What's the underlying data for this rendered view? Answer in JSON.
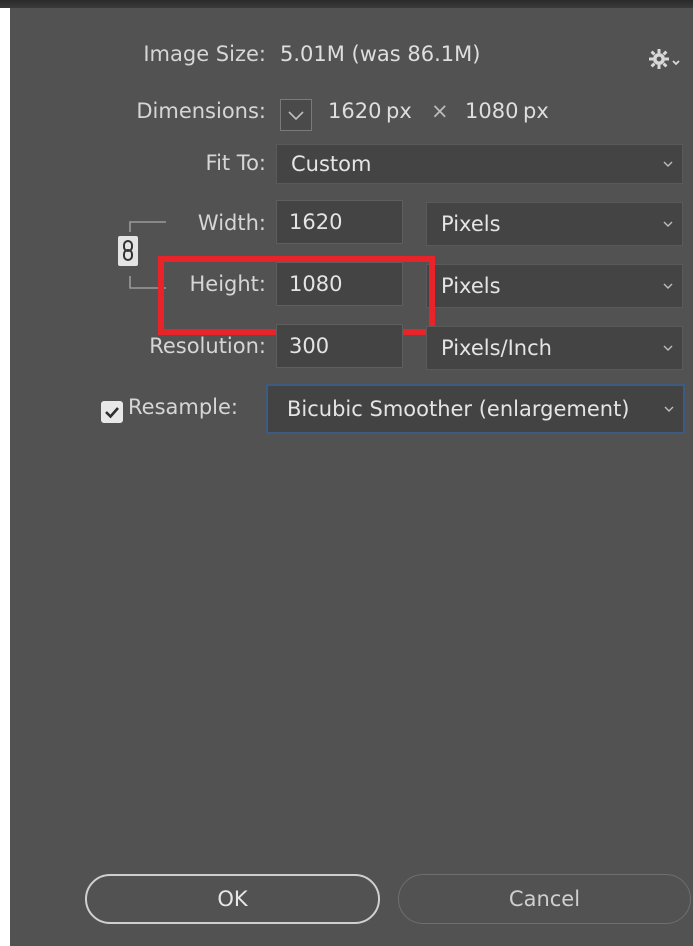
{
  "image_size": {
    "label": "Image Size:",
    "value": "5.01M (was 86.1M)"
  },
  "dimensions": {
    "label": "Dimensions:",
    "width": "1620",
    "times": "×",
    "height": "1080",
    "unit": "px"
  },
  "fit_to": {
    "label": "Fit To:",
    "value": "Custom"
  },
  "width": {
    "label": "Width:",
    "value": "1620",
    "unit": "Pixels"
  },
  "height": {
    "label": "Height:",
    "value": "1080",
    "unit": "Pixels"
  },
  "resolution": {
    "label": "Resolution:",
    "value": "300",
    "unit": "Pixels/Inch"
  },
  "resample": {
    "label": "Resample:",
    "checked": true,
    "method": "Bicubic Smoother (enlargement)"
  },
  "buttons": {
    "ok": "OK",
    "cancel": "Cancel"
  },
  "colors": {
    "dialog_bg": "#525252",
    "field_bg": "#444444",
    "highlight": "#e8232a",
    "focus_border": "#3d5a80"
  },
  "icons": {
    "settings": "gear-icon",
    "link": "chain-link-icon",
    "dropdown": "chevron-down-icon",
    "checkbox": "checkmark-icon"
  }
}
